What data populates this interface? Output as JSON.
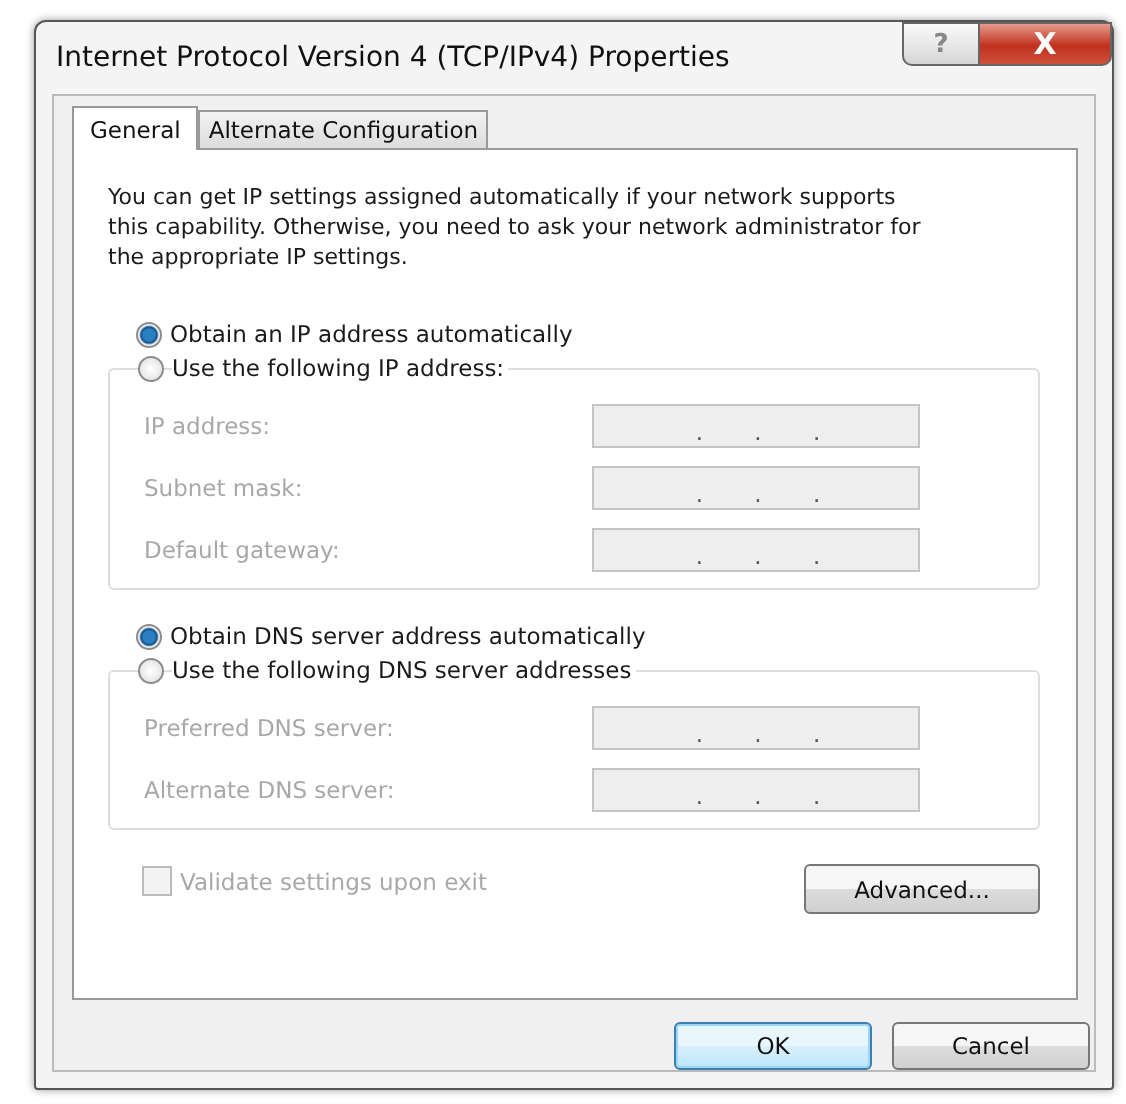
{
  "window": {
    "title": "Internet Protocol Version 4 (TCP/IPv4) Properties",
    "help_button": "?",
    "close_button": "X"
  },
  "tabs": [
    {
      "label": "General",
      "selected": true
    },
    {
      "label": "Alternate Configuration",
      "selected": false
    }
  ],
  "intro": "You can get IP settings assigned automatically if your network supports this capability. Otherwise, you need to ask your network administrator for the appropriate IP settings.",
  "sections": [
    {
      "auto_option": {
        "label": "Obtain an IP address automatically",
        "selected": true
      },
      "manual_option": {
        "label": "Use the following IP address:",
        "selected": false
      },
      "fields": [
        {
          "label": "IP address:",
          "disabled": true,
          "separators": [
            ".",
            ".",
            "."
          ]
        },
        {
          "label": "Subnet mask:",
          "disabled": true,
          "separators": [
            ".",
            ".",
            "."
          ]
        },
        {
          "label": "Default gateway:",
          "disabled": true,
          "separators": [
            ".",
            ".",
            "."
          ]
        }
      ]
    },
    {
      "auto_option": {
        "label": "Obtain DNS server address automatically",
        "selected": true
      },
      "manual_option": {
        "label": "Use the following DNS server addresses",
        "selected": false
      },
      "fields": [
        {
          "label": "Preferred DNS server:",
          "disabled": true,
          "separators": [
            ".",
            ".",
            "."
          ]
        },
        {
          "label": "Alternate DNS server:",
          "disabled": true,
          "separators": [
            ".",
            ".",
            "."
          ]
        }
      ]
    }
  ],
  "validate_checkbox": {
    "label": "Validate settings upon exit",
    "checked": false,
    "disabled": true
  },
  "advanced_button": "Advanced...",
  "buttons": [
    {
      "label": "OK",
      "default": true
    },
    {
      "label": "Cancel",
      "default": false
    }
  ]
}
